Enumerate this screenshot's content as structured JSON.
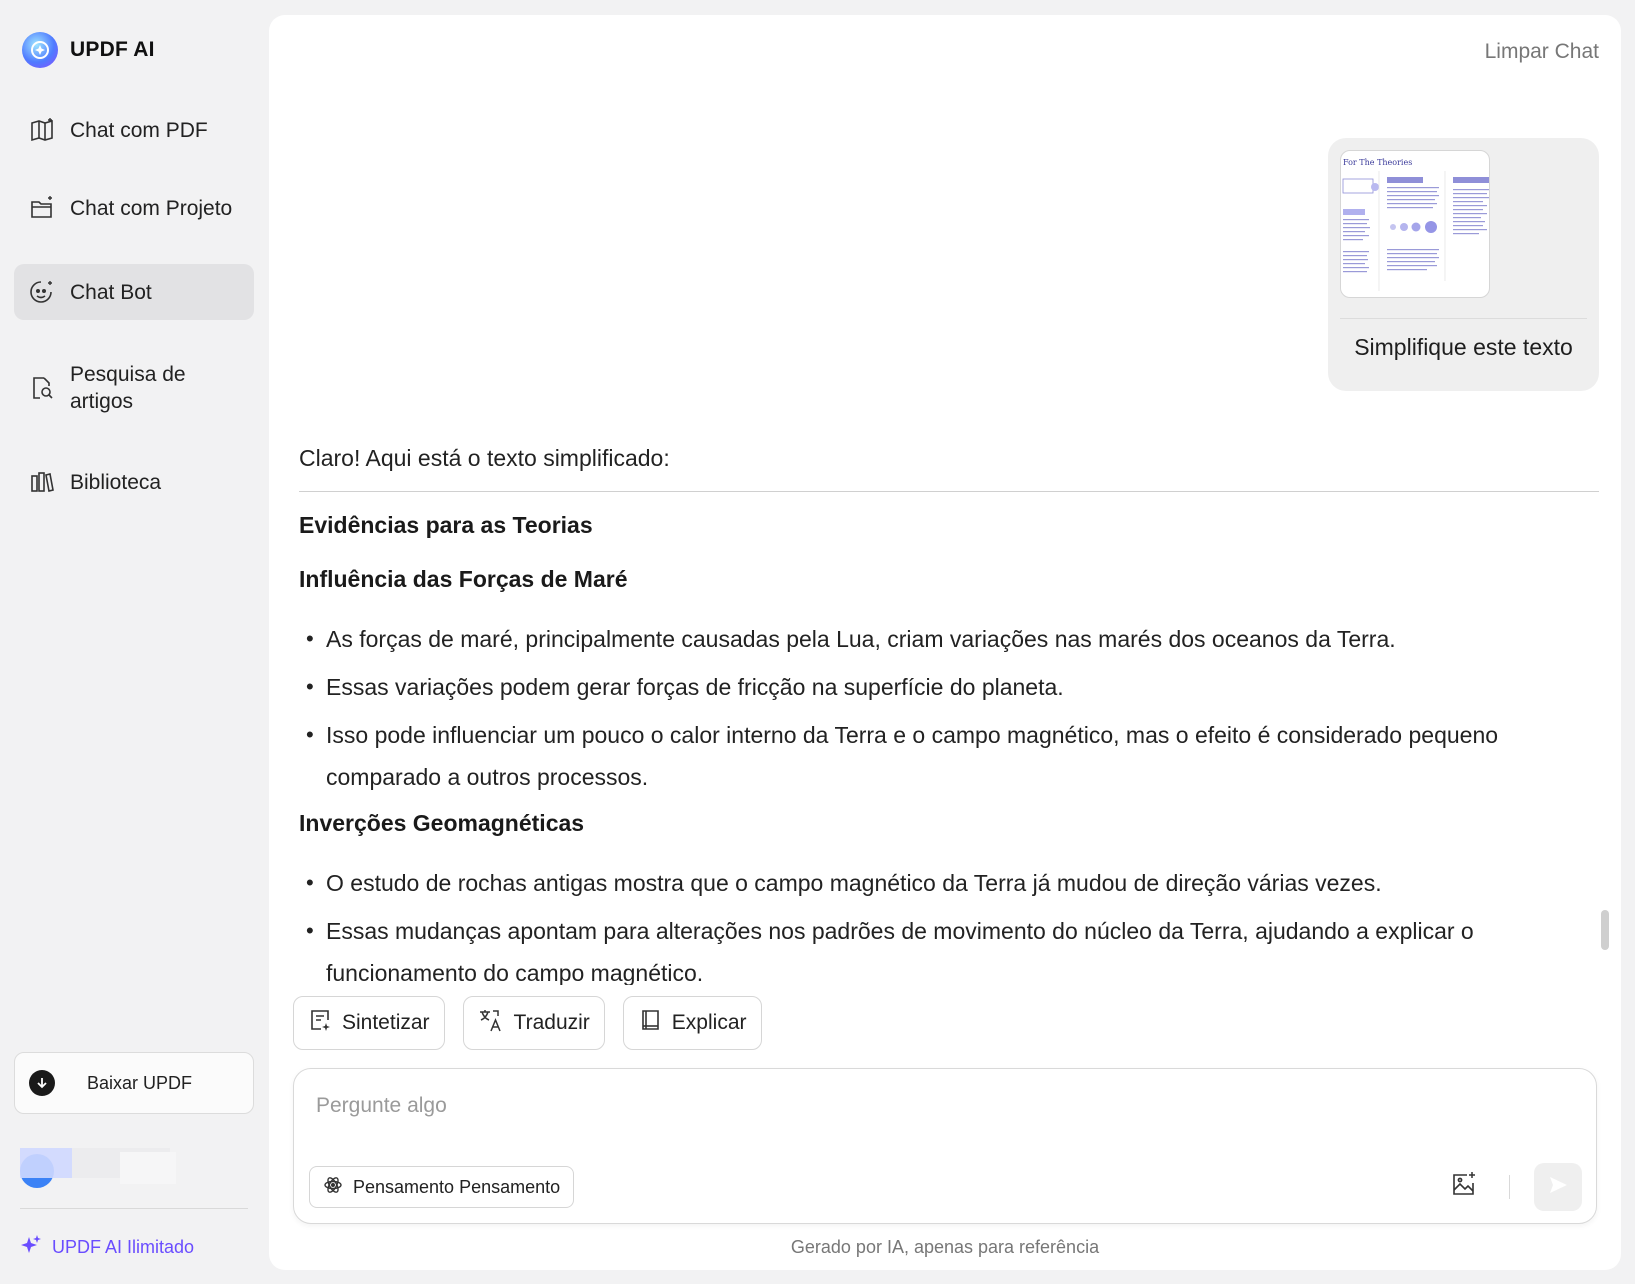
{
  "brand": {
    "title": "UPDF AI"
  },
  "sidebar": {
    "items": [
      {
        "label": "Chat com PDF",
        "icon": "book-sparkle-icon",
        "active": false
      },
      {
        "label": "Chat com Projeto",
        "icon": "folder-sparkle-icon",
        "active": false
      },
      {
        "label": "Chat Bot",
        "icon": "bot-face-icon",
        "active": true
      },
      {
        "label": "Pesquisa de artigos",
        "icon": "document-search-icon",
        "active": false
      },
      {
        "label": "Biblioteca",
        "icon": "library-icon",
        "active": false
      }
    ],
    "download_label": "Baixar UPDF",
    "unlimited_label": "UPDF AI Ilimitado"
  },
  "header": {
    "clear_chat": "Limpar Chat"
  },
  "user_message": {
    "thumbnail_title": "For The Theories",
    "text": "Simplifique este texto"
  },
  "answer": {
    "intro": "Claro! Aqui está o texto simplificado:",
    "heading_main": "Evidências para as Teorias",
    "section1": {
      "heading": "Influência das Forças de Maré",
      "bullets": [
        "As forças de maré, principalmente causadas pela Lua, criam variações nas marés dos oceanos da Terra.",
        "Essas variações podem gerar forças de fricção na superfície do planeta.",
        "Isso pode influenciar um pouco o calor interno da Terra e o campo magnético, mas o efeito é considerado pequeno comparado a outros processos."
      ]
    },
    "section2": {
      "heading": "Inverções Geomagnéticas",
      "bullets": [
        "O estudo de rochas antigas mostra que o campo magnético da Terra já mudou de direção várias vezes.",
        "Essas mudanças apontam para alterações nos padrões de movimento do núcleo da Terra, ajudando a explicar o funcionamento do campo magnético."
      ]
    }
  },
  "quick_actions": [
    {
      "label": "Sintetizar",
      "icon": "summarize-icon"
    },
    {
      "label": "Traduzir",
      "icon": "translate-icon"
    },
    {
      "label": "Explicar",
      "icon": "book-icon"
    }
  ],
  "composer": {
    "placeholder": "Pergunte algo",
    "value": "",
    "thinking_label": "Pensamento Pensamento"
  },
  "footer": {
    "disclaimer": "Gerado por IA, apenas para referência"
  },
  "colors": {
    "accent": "#6a4dff",
    "active_nav": "#e2e2e4",
    "background": "#f2f2f3"
  }
}
